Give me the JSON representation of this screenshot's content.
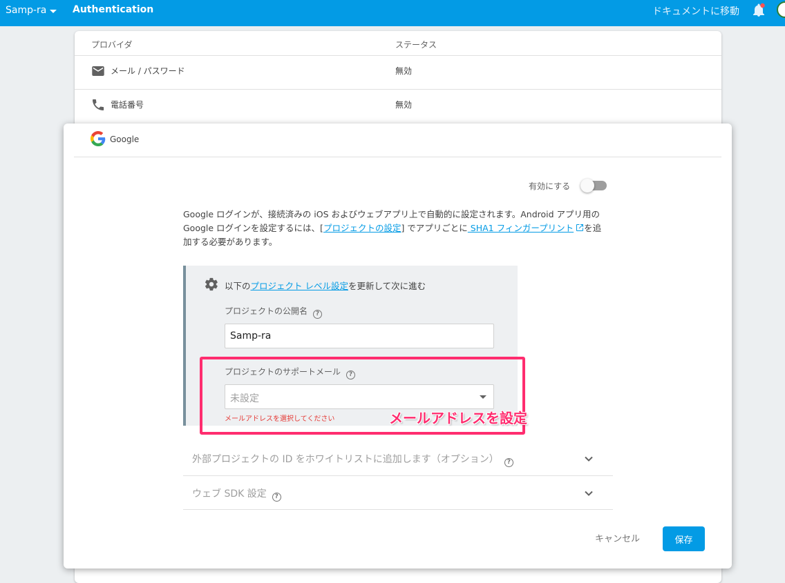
{
  "topbar": {
    "project": "Samp-ra",
    "section": "Authentication",
    "docs_link": "ドキュメントに移動"
  },
  "providers_table": {
    "headers": {
      "provider": "プロバイダ",
      "status": "ステータス"
    },
    "rows": [
      {
        "icon": "email-icon",
        "name": "メール / パスワード",
        "status": "無効"
      },
      {
        "icon": "phone-icon",
        "name": "電話番号",
        "status": "無効"
      }
    ]
  },
  "dialog": {
    "provider_name": "Google",
    "enable_label": "有効にする",
    "enabled": false,
    "description": {
      "part1": "Google ログインが、接続済みの iOS およびウェブアプリ上で自動的に設定されます。Android アプリ用の Google ログインを設定するには、[",
      "link1": "プロジェクトの設定",
      "part2": "] でアプリごとに",
      "link2": " SHA1 フィンガープリント",
      "part3": "を追加する必要があります。"
    },
    "settings": {
      "prefix": "以下の",
      "link": "プロジェクト レベル設定",
      "suffix": "を更新して次に進む",
      "public_name_label": "プロジェクトの公開名",
      "public_name_value": "Samp-ra",
      "support_email_label": "プロジェクトのサポートメール",
      "support_email_value": "未設定",
      "support_email_error": "メールアドレスを選択してください"
    },
    "annotation": "メールアドレスを設定",
    "expanders": [
      {
        "label": "外部プロジェクトの ID をホワイトリストに追加します（オプション）"
      },
      {
        "label": "ウェブ SDK 設定"
      }
    ],
    "cancel_label": "キャンセル",
    "save_label": "保存"
  },
  "colors": {
    "topbar": "#039be5",
    "accent": "#039be5",
    "error": "#e53935",
    "highlight": "#ff2d6f"
  }
}
